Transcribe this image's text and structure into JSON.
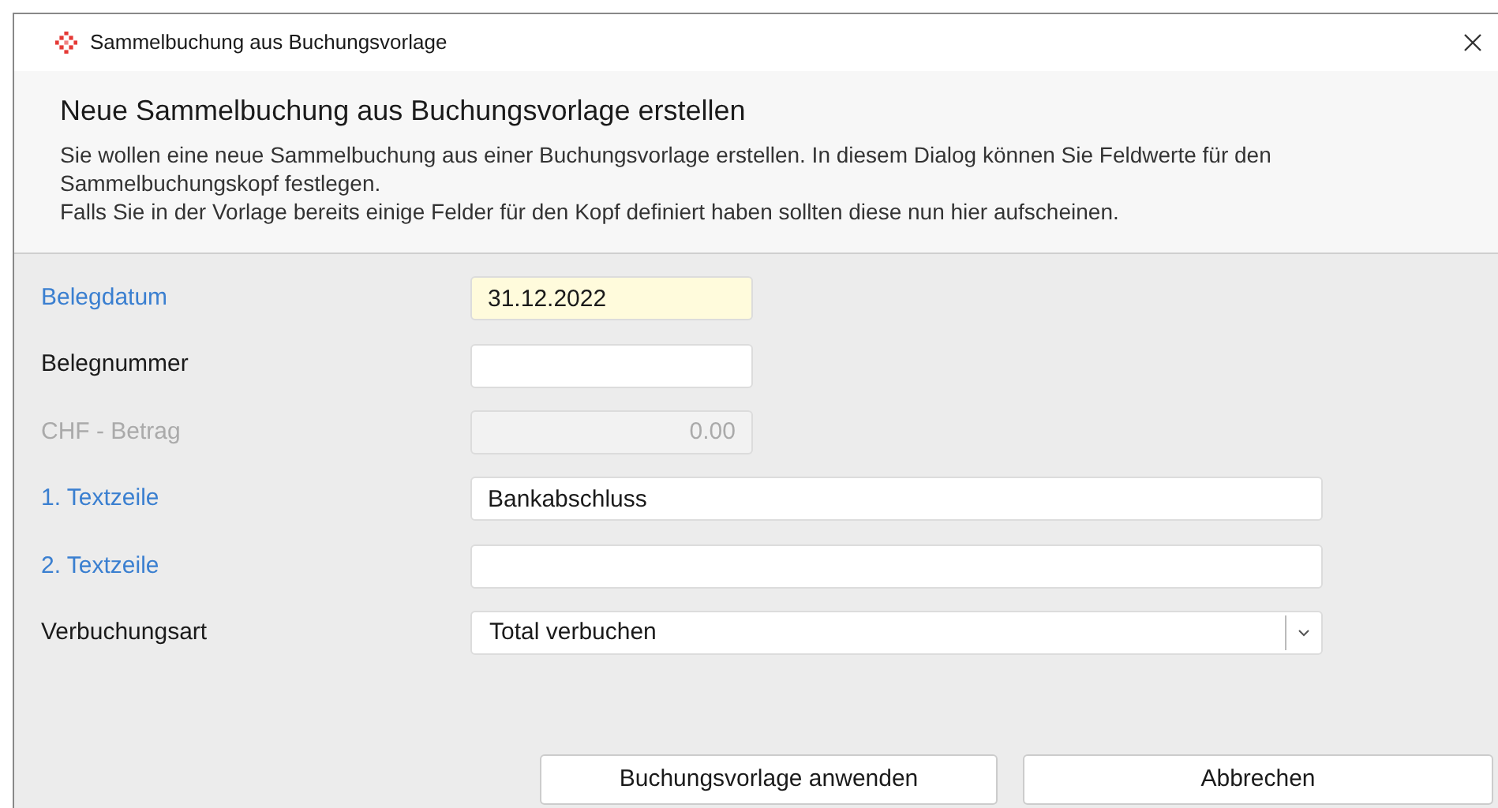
{
  "window": {
    "title": "Sammelbuchung aus Buchungsvorlage"
  },
  "header": {
    "heading": "Neue Sammelbuchung aus Buchungsvorlage erstellen",
    "description": [
      "Sie wollen eine neue Sammelbuchung aus einer Buchungsvorlage erstellen. In diesem Dialog können Sie Feldwerte für den Sammelbuchungskopf festlegen.",
      "Falls Sie in der Vorlage bereits einige Felder für den Kopf definiert haben sollten diese nun hier aufscheinen."
    ]
  },
  "fields": [
    {
      "label": "Belegdatum",
      "kind": "short_text",
      "required": true,
      "focused": true,
      "disabled": false,
      "value": "31.12.2022"
    },
    {
      "label": "Belegnummer",
      "kind": "short_text",
      "required": false,
      "focused": false,
      "disabled": false
    },
    {
      "label": "CHF - Betrag",
      "kind": "number",
      "focused": false,
      "disabled": true,
      "value": "0.00"
    },
    {
      "label": "1. Textzeile",
      "kind": "long_text",
      "required": true,
      "focused": false,
      "disabled": false,
      "value": "Bankabschluss"
    },
    {
      "label": "2. Textzeile",
      "kind": "long_text",
      "required": true,
      "focused": false,
      "disabled": false
    },
    {
      "label": "Verbuchungsart",
      "kind": "select",
      "required": false,
      "focused": false,
      "disabled": false,
      "value": "Total verbuchen"
    }
  ],
  "buttons": [
    "Buchungsvorlage anwenden",
    "Abbrechen"
  ]
}
